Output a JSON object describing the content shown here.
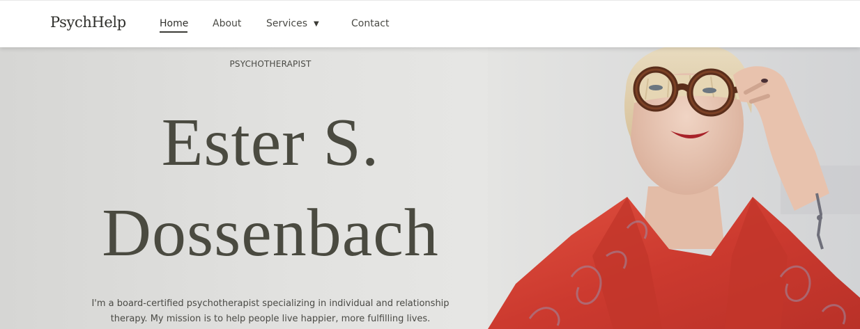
{
  "nav": {
    "brand": "PsychHelp",
    "links": [
      {
        "label": "Home",
        "active": true
      },
      {
        "label": "About"
      },
      {
        "label": "Services",
        "has_dropdown": true
      },
      {
        "label": "Contact"
      }
    ],
    "dropdown_icon": "caret-down-icon"
  },
  "hero": {
    "eyebrow": "PSYCHOTHERAPIST",
    "name_line_1": "Ester S.",
    "name_line_2": "Dossenbach",
    "intro": "I'm a board-certified psychotherapist specializing in individual and relationship therapy. My mission is to help people live happier, more fulfilling lives.",
    "image": "portrait of a woman with blonde bangs wearing tortoiseshell glasses and a red patterned shawl"
  },
  "colors": {
    "heading": "#4a4a40",
    "text": "#4a4a45",
    "shawl": "#d8453a",
    "background": "#e2e2e0"
  }
}
